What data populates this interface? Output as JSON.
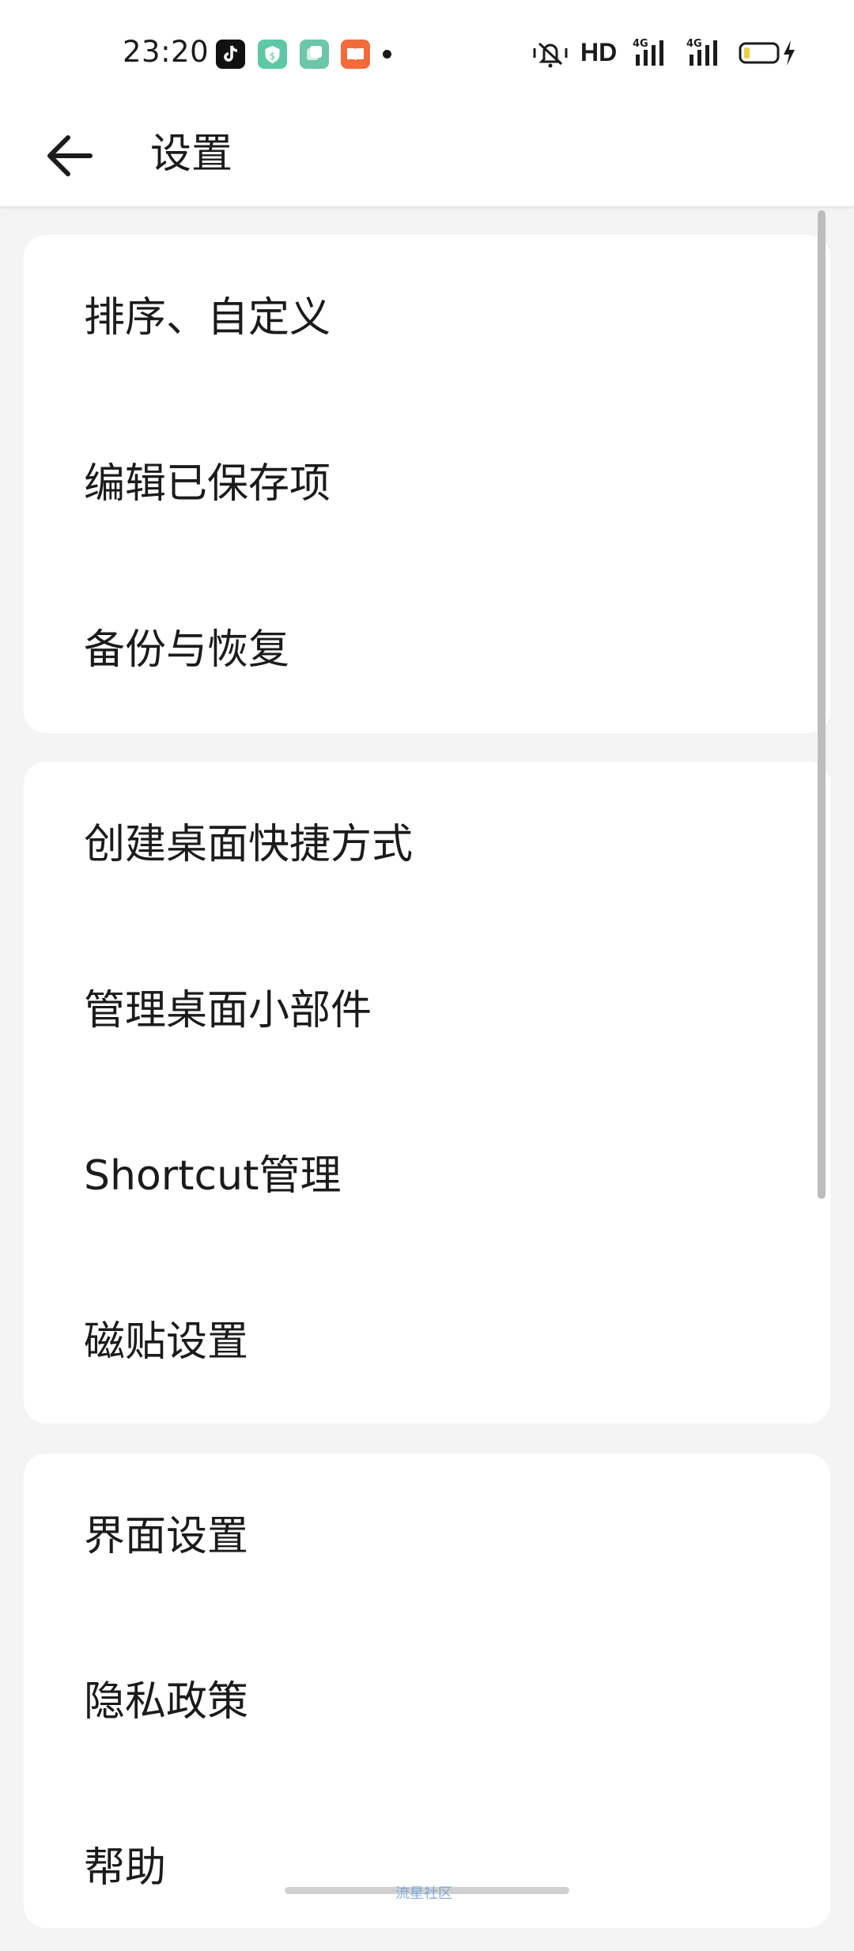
{
  "status_bar": {
    "time": "23:20",
    "network": "HD",
    "apps": [
      {
        "icon": "tiktok-icon",
        "color": "#111111"
      },
      {
        "icon": "shield-app-icon",
        "color": "#5ec8a6"
      },
      {
        "icon": "gallery-app-icon",
        "color": "#6cc6a8"
      },
      {
        "icon": "book-app-icon",
        "color": "#f26b3a"
      }
    ]
  },
  "header": {
    "title": "设置",
    "back_icon": "arrow-left-icon"
  },
  "groups": [
    {
      "items": [
        {
          "label": "排序、自定义"
        },
        {
          "label": "编辑已保存项"
        },
        {
          "label": "备份与恢复"
        }
      ]
    },
    {
      "items": [
        {
          "label": "创建桌面快捷方式"
        },
        {
          "label": "管理桌面小部件"
        },
        {
          "label": "Shortcut管理"
        },
        {
          "label": "磁贴设置"
        }
      ]
    },
    {
      "items": [
        {
          "label": "界面设置"
        },
        {
          "label": "隐私政策"
        },
        {
          "label": "帮助"
        }
      ]
    }
  ],
  "watermark": "流星社区"
}
